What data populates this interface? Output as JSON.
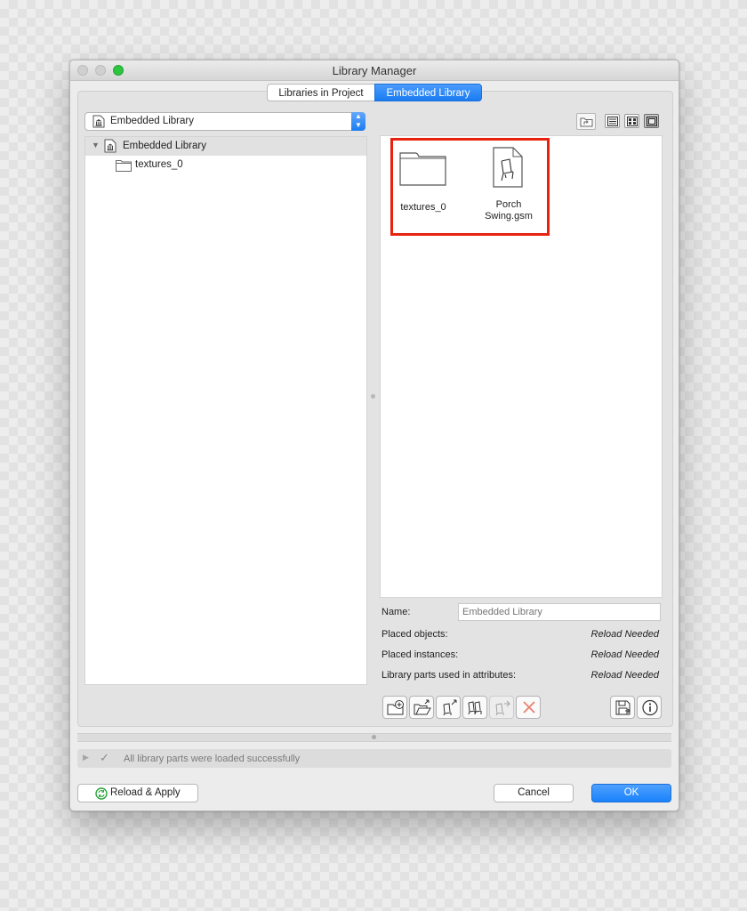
{
  "window": {
    "title": "Library Manager"
  },
  "tabs": [
    {
      "label": "Libraries in Project",
      "selected": false
    },
    {
      "label": "Embedded Library",
      "selected": true
    }
  ],
  "library_select": {
    "value": "Embedded Library"
  },
  "tree": {
    "root": {
      "label": "Embedded Library",
      "expanded": true,
      "icon": "library-icon"
    },
    "children": [
      {
        "label": "textures_0",
        "icon": "folder-icon"
      }
    ]
  },
  "view_modes": [
    "parent-folder-icon",
    "list-view-icon",
    "grid-view-icon",
    "large-icon-view-icon"
  ],
  "items": [
    {
      "label": "textures_0",
      "icon": "folder-icon"
    },
    {
      "label": "Porch\nSwing.gsm",
      "icon": "gsm-object-icon"
    }
  ],
  "highlight": {
    "color": "#e8220e"
  },
  "info": {
    "name_label": "Name:",
    "name_placeholder": "Embedded Library",
    "placed_objects_label": "Placed objects:",
    "placed_objects_value": "Reload Needed",
    "placed_instances_label": "Placed instances:",
    "placed_instances_value": "Reload Needed",
    "attr_parts_label": "Library parts used in attributes:",
    "attr_parts_value": "Reload Needed"
  },
  "toolbar": {
    "tools": [
      "new-folder-icon",
      "open-folder-icon",
      "import-object-icon",
      "duplicate-object-icon",
      "move-object-icon",
      "delete-icon",
      "save-icon",
      "info-icon"
    ]
  },
  "status": {
    "message": "All library parts were loaded successfully",
    "icon": "checkmark-icon"
  },
  "footer": {
    "reload_label": "Reload & Apply",
    "cancel_label": "Cancel",
    "ok_label": "OK"
  },
  "colors": {
    "accent": "#1a7cf2",
    "ok_button": "#1a82fb",
    "delete": "#e8816f"
  }
}
